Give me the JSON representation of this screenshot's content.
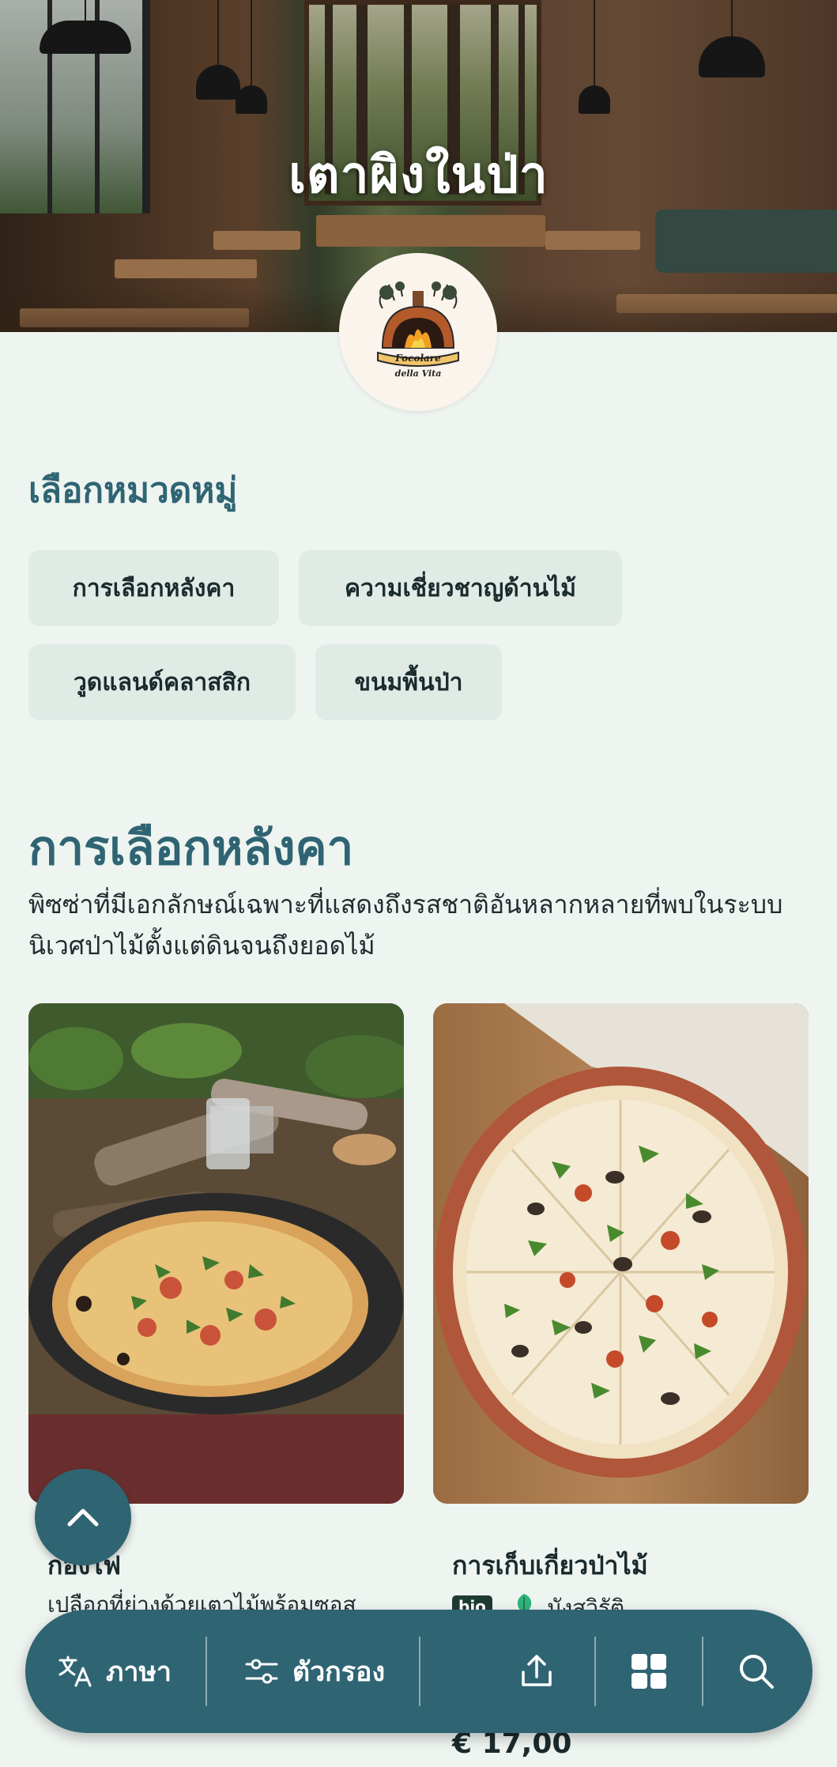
{
  "hero": {
    "title": "เตาผิงในป่า",
    "logo": {
      "line1": "Focolare",
      "line2": "della Vita"
    }
  },
  "categories": {
    "heading": "เลือกหมวดหมู่",
    "items": [
      {
        "label": "การเลือกหลังคา"
      },
      {
        "label": "ความเชี่ยวชาญด้านไม้"
      },
      {
        "label": "วูดแลนด์คลาสสิก"
      },
      {
        "label": "ขนมพื้นป่า"
      }
    ]
  },
  "section": {
    "title": "การเลือกหลังคา",
    "description": "พิซซ่าที่มีเอกลักษณ์เฉพาะที่แสดงถึงรสชาติอันหลากหลายที่พบในระบบนิเวศป่าไม้ตั้งแต่ดินจนถึงยอดไม้"
  },
  "products": [
    {
      "name": "กองไฟ",
      "description": "เปลือกที่ย่างด้วยเตาไม้พร้อมซอส"
    },
    {
      "name": "การเก็บเกี่ยวป่าไม้",
      "badge": "bio",
      "tag": "มังสวิรัติ",
      "price": "€ 17,00"
    }
  ],
  "toolbar": {
    "language_label": "ภาษา",
    "filter_label": "ตัวกรอง"
  },
  "colors": {
    "accent": "#2f6473",
    "background": "#eef4f0",
    "chip": "#e0ebe6"
  }
}
